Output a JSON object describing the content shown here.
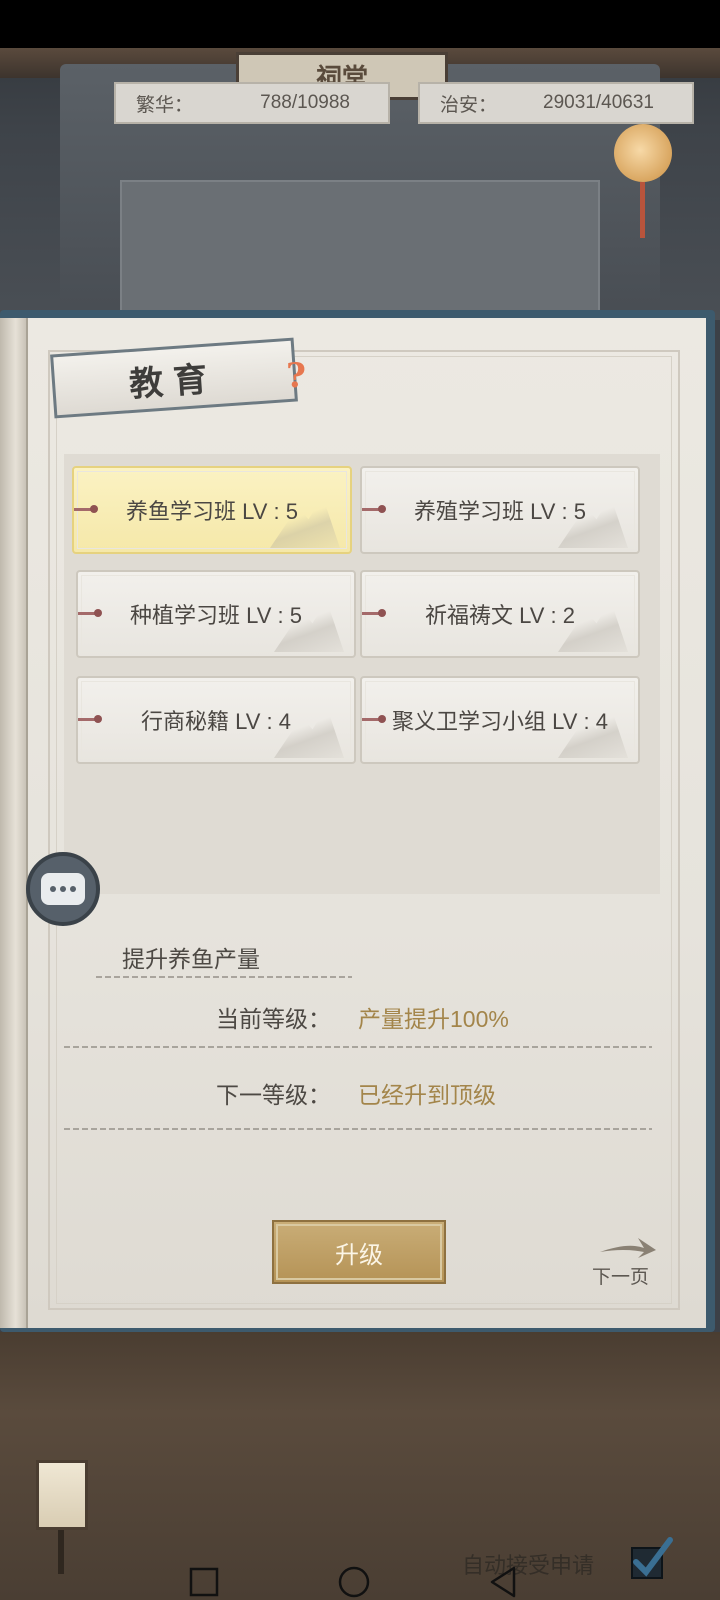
{
  "scene": {
    "sign_text": "祠堂"
  },
  "stats": {
    "prosperity": {
      "label": "繁华：",
      "value": "788/10988"
    },
    "security": {
      "label": "治安：",
      "value": "29031/40631"
    }
  },
  "panel": {
    "title": "教育",
    "help_icon": "?"
  },
  "courses": [
    {
      "name": "养鱼学习班",
      "level": "LV : 5",
      "selected": true
    },
    {
      "name": "养殖学习班",
      "level": "LV : 5",
      "selected": false
    },
    {
      "name": "种植学习班",
      "level": "LV : 5",
      "selected": false
    },
    {
      "name": "祈福祷文",
      "level": "LV : 2",
      "selected": false
    },
    {
      "name": "行商秘籍",
      "level": "LV : 4",
      "selected": false
    },
    {
      "name": "聚义卫学习小组",
      "level": "LV : 4",
      "selected": false
    }
  ],
  "detail": {
    "description": "提升养鱼产量",
    "current_label": "当前等级：",
    "current_value": "产量提升100%",
    "next_label": "下一等级：",
    "next_value": "已经升到顶级"
  },
  "actions": {
    "upgrade_label": "升级",
    "next_page_label": "下一页"
  },
  "footer": {
    "auto_accept_label": "自动接受申请",
    "auto_accept_checked": true
  },
  "colors": {
    "selected_card": "#f5e8a9",
    "value_gold": "#a3854a",
    "upgrade_button": "#b59356",
    "checkbox_check": "#3a6f93"
  },
  "icons": [
    "help-icon",
    "chat-icon",
    "next-arrow-icon",
    "checkbox-check-icon",
    "lamp-icon",
    "nav-square-icon",
    "nav-circle-icon",
    "nav-back-icon"
  ]
}
